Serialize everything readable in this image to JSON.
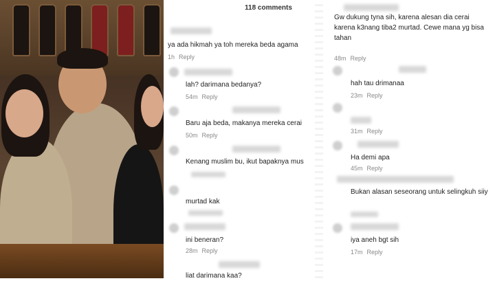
{
  "header": {
    "comments_count": "118 comments"
  },
  "left_comments": [
    {
      "text": "ya ada hikmah ya toh mereka beda agama",
      "time": "1h",
      "reply": "Reply"
    },
    {
      "text": "lah? darimana bedanya?",
      "time": "54m",
      "reply": "Reply"
    },
    {
      "text": "Baru aja beda, makanya mereka cerai",
      "time": "50m",
      "reply": "Reply"
    },
    {
      "text": "Kenang muslim bu, ikut bapaknya mus",
      "time": "",
      "reply": ""
    },
    {
      "text": "murtad kak",
      "time": "",
      "reply": ""
    },
    {
      "text": "ini beneran?",
      "time": "28m",
      "reply": "Reply"
    },
    {
      "text": "liat darimana kaa?",
      "time": "",
      "reply": ""
    }
  ],
  "right_comments": [
    {
      "text": "Gw dukung tyna sih, karena alesan dia cerai karena k3nang tiba2 murtad. Cewe mana yg bisa tahan",
      "time": "48m",
      "reply": "Reply"
    },
    {
      "text": "hah tau drimanaa",
      "time": "23m",
      "reply": "Reply"
    },
    {
      "text": "",
      "time": "31m",
      "reply": "Reply"
    },
    {
      "text": "Ha demi apa",
      "time": "45m",
      "reply": "Reply"
    },
    {
      "text": "Bukan alasan seseorang untuk selingkuh siiy",
      "time": "",
      "reply": ""
    },
    {
      "text": "iya aneh bgt sih",
      "time": "17m",
      "reply": "Reply"
    }
  ]
}
